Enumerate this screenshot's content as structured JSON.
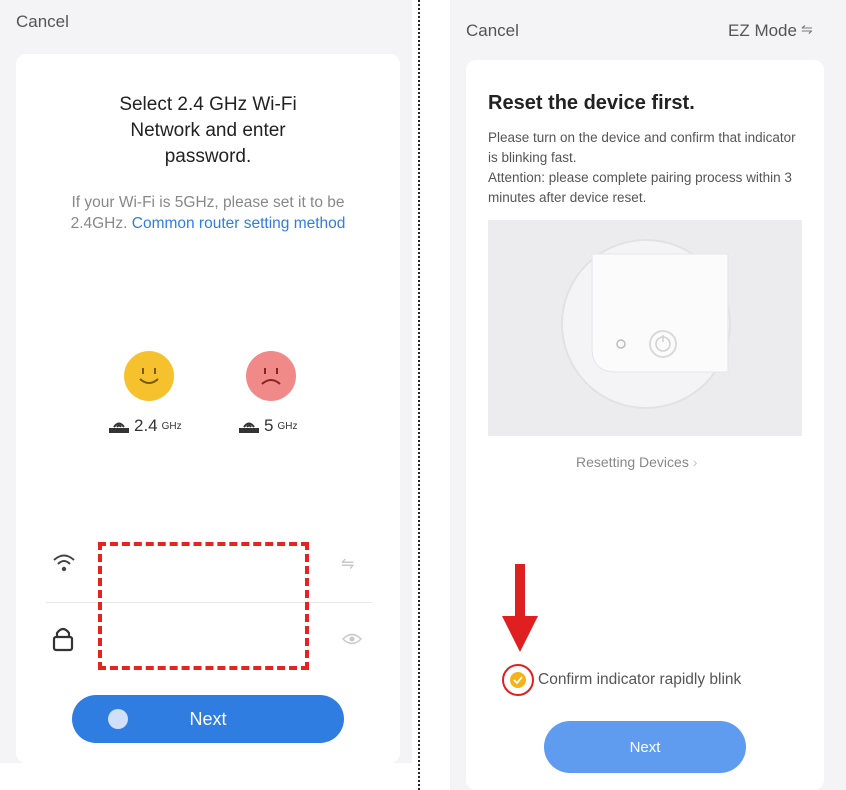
{
  "left": {
    "cancel_label": "Cancel",
    "title": "Select 2.4 GHz Wi-Fi Network and enter password.",
    "hint_text": "If your Wi-Fi is 5GHz, please set it to be 2.4GHz.",
    "hint_link": "Common router setting method",
    "band_24_big": "2.4",
    "band_24_small": "GHz",
    "band_5_big": "5",
    "band_5_small": "GHz",
    "next_label": "Next",
    "colors": {
      "accent": "#2f7de1",
      "happy": "#f5c22e",
      "sad": "#f08a88",
      "highlight": "#e52420"
    }
  },
  "right": {
    "cancel_label": "Cancel",
    "mode_label": "EZ Mode",
    "title": "Reset the device first.",
    "desc": "Please turn on the device and confirm that indicator is blinking fast.",
    "attention": "Attention: please complete pairing process within 3 minutes after device reset.",
    "resetting_link": "Resetting Devices",
    "confirm_label": "Confirm indicator rapidly blink",
    "next_label": "Next",
    "colors": {
      "button": "#5f9cf0",
      "check": "#f5b21b",
      "annotation": "#e02020"
    }
  }
}
